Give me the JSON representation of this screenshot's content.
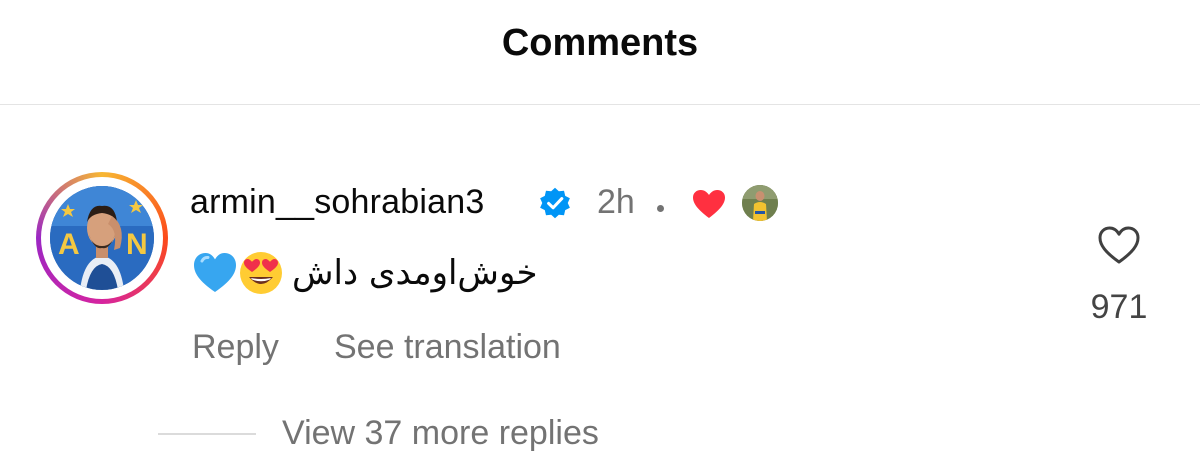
{
  "header": {
    "title": "Comments"
  },
  "comment": {
    "username": "armin__sohrabian3",
    "verified": true,
    "timestamp": "2h",
    "liked_by_author": true,
    "text": "خوش‌اومدی داش",
    "emojis": [
      "smiling-face-with-heart-eyes-emoji",
      "blue-heart-emoji"
    ],
    "reply_label": "Reply",
    "translate_label": "See translation",
    "like_count": "971",
    "view_replies_label": "View 37 more replies"
  },
  "colors": {
    "text_primary": "#0a0a0a",
    "text_secondary": "#737373",
    "verified_blue": "#0095f6",
    "like_red": "#ff3040",
    "divider": "#e4e4e4"
  }
}
